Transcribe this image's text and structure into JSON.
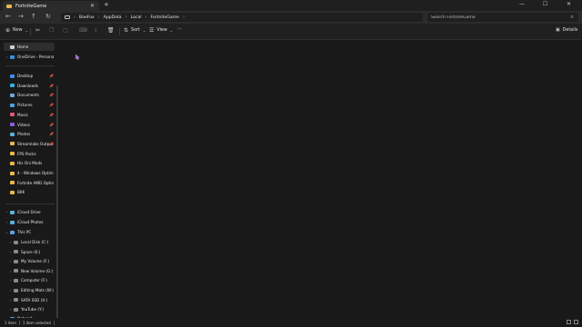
{
  "tab": {
    "title": "FortniteGame",
    "close": "✕"
  },
  "window": {
    "new_tab": "+",
    "minimize": "—",
    "maximize": "☐",
    "close": "✕"
  },
  "nav": {
    "back": "←",
    "forward": "→",
    "up": "↑",
    "refresh": "↻"
  },
  "address": {
    "crumbs": [
      "BaeFox",
      "AppData",
      "Local",
      "FortniteGame"
    ],
    "separator": "›"
  },
  "search": {
    "placeholder": "Search FortniteGame"
  },
  "toolbar": {
    "new_label": "New",
    "sort_label": "Sort",
    "view_label": "View",
    "more_label": "···",
    "details_label": "Details"
  },
  "sidebar": {
    "home": "Home",
    "onedrive": "OneDrive - Personal",
    "quick_access": [
      {
        "label": "Desktop",
        "color": "#3a8ee6"
      },
      {
        "label": "Downloads",
        "color": "#3ab0e6"
      },
      {
        "label": "Documents",
        "color": "#6fa8dc"
      },
      {
        "label": "Pictures",
        "color": "#4aa3e0"
      },
      {
        "label": "Music",
        "color": "#e05a7a"
      },
      {
        "label": "Videos",
        "color": "#8a5ae0"
      },
      {
        "label": "Photos",
        "color": "#5ab0e0"
      },
      {
        "label": "Streamlabs Output",
        "color": "#e8b94e"
      },
      {
        "label": "FPS Packs",
        "color": "#e8b94e"
      },
      {
        "label": "His Oni Mods",
        "color": "#e8b94e"
      },
      {
        "label": "4 - Windows Optimiz",
        "color": "#e8b94e"
      },
      {
        "label": "Fortnite AMD Optimiz",
        "color": "#e8b94e"
      },
      {
        "label": "BKK",
        "color": "#e8b94e"
      }
    ],
    "cloud": [
      {
        "label": "iCloud Drive"
      },
      {
        "label": "iCloud Photos"
      }
    ],
    "this_pc": "This PC",
    "drives": [
      "Local Disk (C:)",
      "Space (E:)",
      "My Volume (F:)",
      "New Volume (G:)",
      "Computer (F:)",
      "Editing Mats (W:)",
      "SATA SSD (X:)",
      "YouTube (Y:)"
    ],
    "network": "Network"
  },
  "status": {
    "items": "1 item",
    "selected": "1 item selected"
  }
}
